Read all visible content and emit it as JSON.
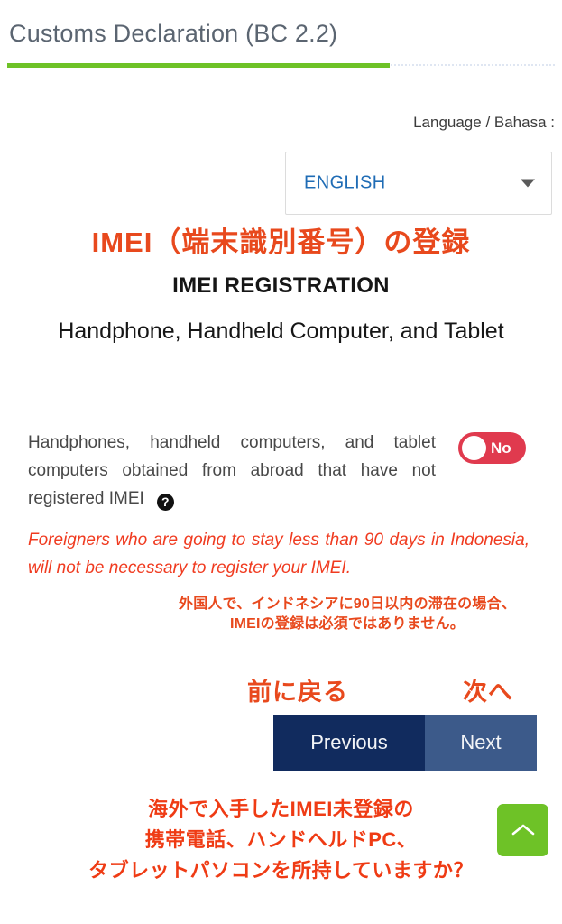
{
  "header": {
    "title": "Customs Declaration (BC 2.2)",
    "rule_color_green": "#6ec227",
    "rule_color_dotted": "#dfe6f2"
  },
  "language": {
    "label": "Language / Bahasa :",
    "selected": "ENGLISH",
    "caret_icon": "chevron-down-icon"
  },
  "headings": {
    "jp_title": "IMEI（端末識別番号）の登録",
    "en_title": "IMEI REGISTRATION",
    "subtitle": "Handphone, Handheld Computer, and Tablet"
  },
  "question": {
    "text": "Handphones, handheld computers, and tablet computers obtained from abroad that have not registered IMEI",
    "help_icon": "help-question-icon",
    "help_glyph": "?",
    "toggle": {
      "value": "No",
      "state": "off",
      "color": "#e03a4e"
    }
  },
  "note": {
    "english": "Foreigners who are going to stay less than 90 days in Indonesia, will not be necessary to register your IMEI.",
    "japanese_line1": "外国人で、インドネシアに90日以内の滞在の場合、",
    "japanese_line2": "IMEIの登録は必須ではありません。",
    "color": "#f03b20"
  },
  "navigation": {
    "prev_jp": "前に戻る",
    "next_jp": "次へ",
    "prev_label": "Previous",
    "next_label": "Next",
    "prev_color": "#112b5e",
    "next_color": "#3c5a8a"
  },
  "bottom": {
    "line1": "海外で入手したIMEI未登録の",
    "line2": "携帯電話、ハンドヘルドPC、",
    "line3": "タブレットパソコンを所持していますか？",
    "color": "#ef3b14"
  },
  "scroll_top": {
    "icon": "chevron-up-icon",
    "color": "#6ec227"
  }
}
